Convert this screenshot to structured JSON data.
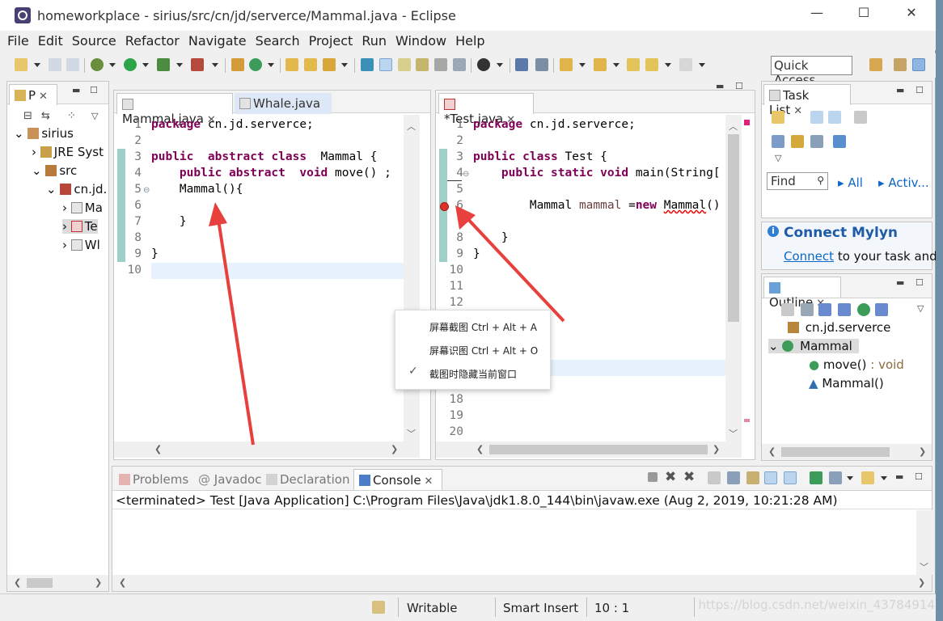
{
  "window": {
    "title": "homeworkplace - sirius/src/cn/jd/serverce/Mammal.java - Eclipse",
    "minimize": "—",
    "maximize": "☐",
    "close": "✕"
  },
  "menu": [
    "File",
    "Edit",
    "Source",
    "Refactor",
    "Navigate",
    "Search",
    "Project",
    "Run",
    "Window",
    "Help"
  ],
  "quick_access": {
    "placeholder": "Quick Access"
  },
  "package_explorer": {
    "tab": "P",
    "items": [
      {
        "label": "sirius"
      },
      {
        "label": "JRE Syst"
      },
      {
        "label": "src"
      },
      {
        "label": "cn.jd."
      },
      {
        "label": "Ma"
      },
      {
        "label": "Te"
      },
      {
        "label": "Wl"
      }
    ]
  },
  "editor_left": {
    "tabs": [
      {
        "label": "Mammal.java"
      },
      {
        "label": "Whale.java"
      }
    ],
    "line_numbers": [
      "1",
      "2",
      "3",
      "4",
      "5",
      "6",
      "7",
      "8",
      "9",
      "10"
    ]
  },
  "editor_right": {
    "tabs": [
      {
        "label": "*Test.java"
      }
    ],
    "line_numbers": [
      "1",
      "2",
      "3",
      "4",
      "5",
      "6",
      "7",
      "8",
      "9",
      "10",
      "11",
      "12",
      "18",
      "19",
      "20"
    ]
  },
  "task_list": {
    "tab": "Task List",
    "find_placeholder": "Find",
    "all": "All",
    "activate": "Activ..."
  },
  "mylyn": {
    "title": "Connect Mylyn",
    "link": "Connect",
    "text": "to your task and"
  },
  "outline": {
    "tab": "Outline",
    "items": [
      {
        "label": "cn.jd.serverce"
      },
      {
        "label": "Mammal"
      },
      {
        "label": "move()",
        "suffix": " : void"
      },
      {
        "label": "Mammal()"
      }
    ]
  },
  "bottom_tabs": [
    {
      "label": "Problems"
    },
    {
      "label": "Javadoc"
    },
    {
      "label": "Declaration"
    },
    {
      "label": "Console"
    }
  ],
  "console": {
    "text": "<terminated> Test [Java Application] C:\\Program Files\\Java\\jdk1.8.0_144\\bin\\javaw.exe (Aug 2, 2019, 10:21:28 AM)"
  },
  "context_menu": {
    "items": [
      {
        "label": "屏幕截图 Ctrl + Alt + A"
      },
      {
        "label": "屏幕识图 Ctrl + Alt + O"
      },
      {
        "label": "截图时隐藏当前窗口"
      }
    ]
  },
  "status": {
    "writable": "Writable",
    "insert_mode": "Smart Insert",
    "position": "10 : 1"
  },
  "watermark": "https://blog.csdn.net/weixin_43784914",
  "colors": {
    "keyword": "#7f0055",
    "arrow": "#e8403c",
    "link": "#0b66c6",
    "change_bar": "#9fd0c7"
  }
}
